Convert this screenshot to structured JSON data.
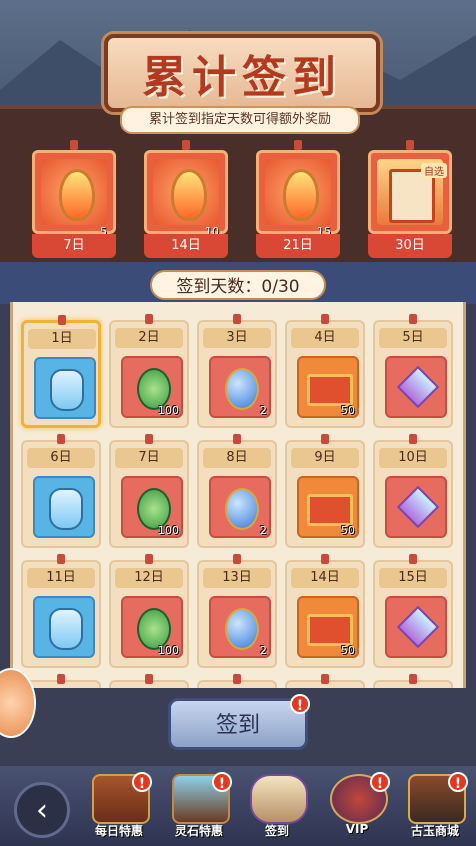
{
  "header": {
    "title": "累计签到",
    "subtitle": "累计签到指定天数可得额外奖励"
  },
  "milestones": [
    {
      "day": "7日",
      "count": "5",
      "icon": "fire-token-icon"
    },
    {
      "day": "14日",
      "count": "10",
      "icon": "fire-token-icon"
    },
    {
      "day": "21日",
      "count": "15",
      "icon": "fire-token-icon"
    },
    {
      "day": "30日",
      "tag": "自选",
      "icon": "character-card-icon"
    }
  ],
  "progress": {
    "label": "签到天数：0/30",
    "current": 0,
    "total": 30
  },
  "days": [
    {
      "label": "1日",
      "type": "blue",
      "icon": "vial-icon",
      "qty": ""
    },
    {
      "label": "2日",
      "type": "red",
      "icon": "jade-icon",
      "qty": "100"
    },
    {
      "label": "3日",
      "type": "red",
      "icon": "orb-icon",
      "qty": "2"
    },
    {
      "label": "4日",
      "type": "orange",
      "icon": "ticket-icon",
      "qty": "50"
    },
    {
      "label": "5日",
      "type": "red",
      "icon": "crystal-icon",
      "qty": ""
    },
    {
      "label": "6日",
      "type": "blue",
      "icon": "vial-icon",
      "qty": ""
    },
    {
      "label": "7日",
      "type": "red",
      "icon": "jade-icon",
      "qty": "100"
    },
    {
      "label": "8日",
      "type": "red",
      "icon": "orb-icon",
      "qty": "2"
    },
    {
      "label": "9日",
      "type": "orange",
      "icon": "ticket-icon",
      "qty": "50"
    },
    {
      "label": "10日",
      "type": "red",
      "icon": "crystal-icon",
      "qty": ""
    },
    {
      "label": "11日",
      "type": "blue",
      "icon": "vial-icon",
      "qty": ""
    },
    {
      "label": "12日",
      "type": "red",
      "icon": "jade-icon",
      "qty": "100"
    },
    {
      "label": "13日",
      "type": "red",
      "icon": "orb-icon",
      "qty": "2"
    },
    {
      "label": "14日",
      "type": "orange",
      "icon": "ticket-icon",
      "qty": "50"
    },
    {
      "label": "15日",
      "type": "red",
      "icon": "crystal-icon",
      "qty": ""
    }
  ],
  "sign_button": {
    "label": "签到",
    "badge": "!"
  },
  "nav": {
    "back_icon": "back-arrow-icon",
    "items": [
      {
        "label": "每日特惠",
        "badge": "!",
        "icon": "treasure-chest-icon"
      },
      {
        "label": "灵石特惠",
        "badge": "!",
        "icon": "ore-chest-icon"
      },
      {
        "label": "签到",
        "badge": "",
        "icon": "scroll-icon"
      },
      {
        "label": "VIP",
        "badge": "!",
        "icon": "vip-emblem-icon"
      },
      {
        "label": "古玉商城",
        "badge": "!",
        "icon": "shop-pavilion-icon"
      }
    ]
  },
  "colors": {
    "accent": "#e9603f",
    "panel": "#f6ebd6",
    "nav": "#2e3450"
  }
}
